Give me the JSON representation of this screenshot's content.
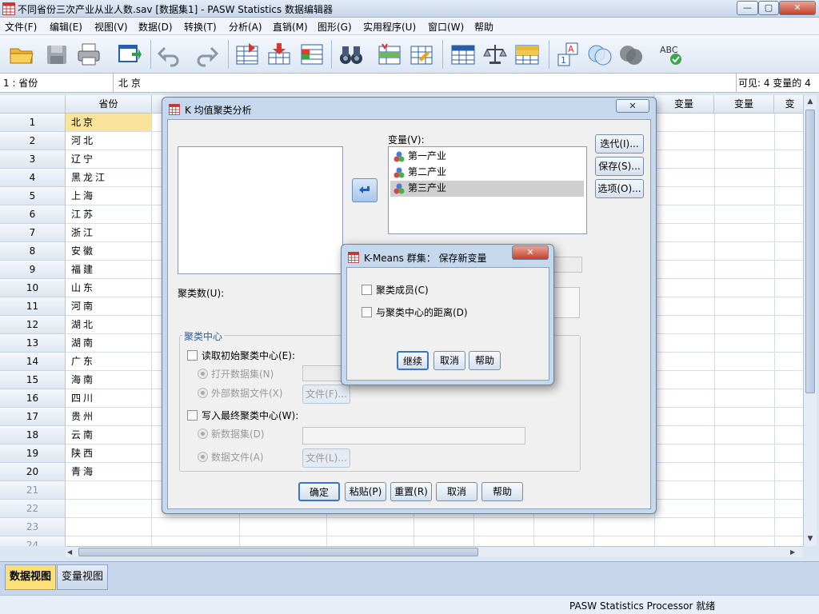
{
  "window": {
    "title": "不同省份三次产业从业人数.sav [数据集1] - PASW Statistics 数据编辑器",
    "min_glyph": "—",
    "max_glyph": "▢",
    "close_glyph": "✕"
  },
  "menu": [
    "文件(F)",
    "编辑(E)",
    "视图(V)",
    "数据(D)",
    "转换(T)",
    "分析(A)",
    "直销(M)",
    "图形(G)",
    "实用程序(U)",
    "窗口(W)",
    "帮助"
  ],
  "cellbar": {
    "ref": "1 : 省份",
    "value": "北 京",
    "visible": "可见:  4 变量的 4"
  },
  "grid": {
    "columns": [
      "省份",
      "变量",
      "变量",
      "变"
    ],
    "rows": [
      "1",
      "2",
      "3",
      "4",
      "5",
      "6",
      "7",
      "8",
      "9",
      "10",
      "11",
      "12",
      "13",
      "14",
      "15",
      "16",
      "17",
      "18",
      "19",
      "20",
      "21",
      "22",
      "23",
      "24"
    ],
    "provinces": [
      "北京",
      "河北",
      "辽宁",
      "黑龙江",
      "上海",
      "江苏",
      "浙江",
      "安徽",
      "福建",
      "山东",
      "河南",
      "湖北",
      "湖南",
      "广东",
      "海南",
      "四川",
      "贵州",
      "云南",
      "陕西",
      "青海"
    ]
  },
  "view_tabs": {
    "data": "数据视图",
    "variable": "变量视图"
  },
  "status": "PASW Statistics Processor 就绪",
  "kmeans": {
    "title": "K 均值聚类分析",
    "close_glyph": "✕",
    "variables_label": "变量(V):",
    "variables": [
      "第一产业",
      "第二产业",
      "第三产业"
    ],
    "cluster_count_label": "聚类数(U):",
    "centers_group": "聚类中心",
    "read_initial": "读取初始聚类中心(E):",
    "open_dataset": "打开数据集(N)",
    "external_file": "外部数据文件(X)",
    "file_btn1": "文件(F)...",
    "write_final": "写入最终聚类中心(W):",
    "new_dataset": "新数据集(D)",
    "data_file": "数据文件(A)",
    "file_btn2": "文件(L)...",
    "side_buttons": {
      "iterate": "迭代(I)...",
      "save": "保存(S)...",
      "options": "选项(O)..."
    },
    "bottom_buttons": {
      "ok": "确定",
      "paste": "粘贴(P)",
      "reset": "重置(R)",
      "cancel": "取消",
      "help": "帮助"
    }
  },
  "save_dialog": {
    "title": "K-Means 群集： 保存新变量",
    "close_glyph": "✕",
    "membership": "聚类成员(C)",
    "distance": "与聚类中心的距离(D)",
    "continue": "继续",
    "cancel": "取消",
    "help": "帮助"
  },
  "colors": {
    "selected_cell": "#fae39a",
    "accent": "#3a76c6"
  }
}
